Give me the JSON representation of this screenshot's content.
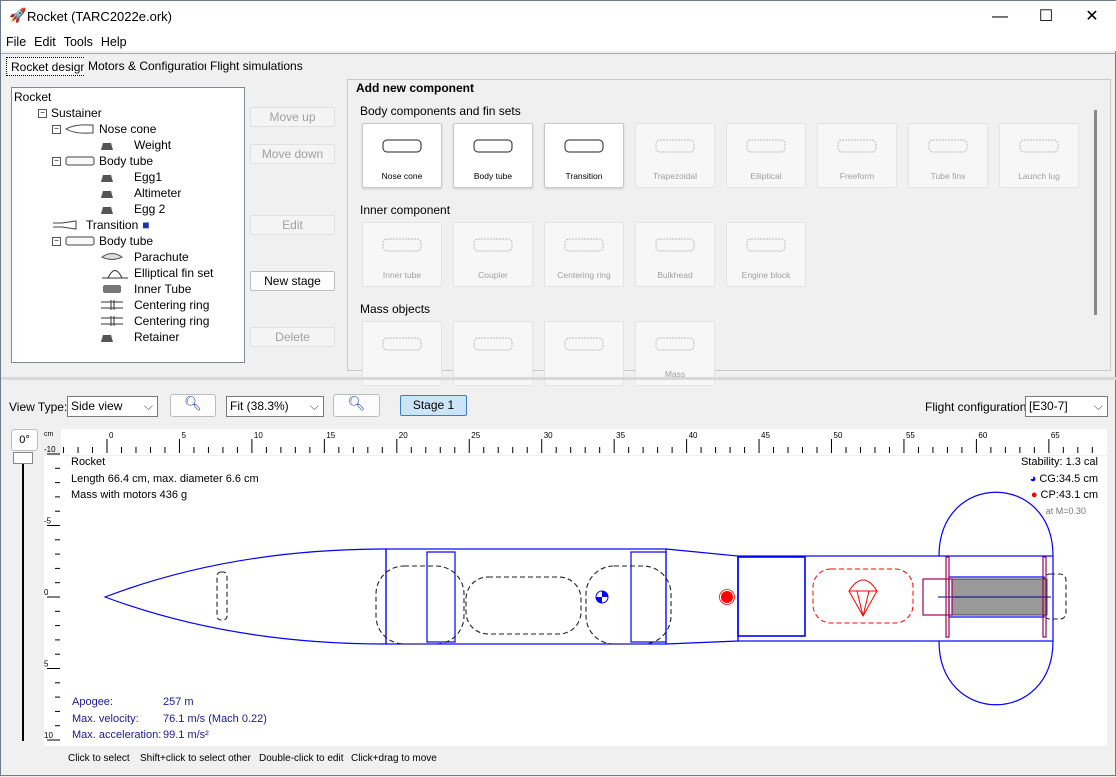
{
  "window": {
    "title": "Rocket (TARC2022e.ork)",
    "minimize": "—",
    "maximize": "☐",
    "close": "✕"
  },
  "menu": [
    "File",
    "Edit",
    "Tools",
    "Help"
  ],
  "tabs": [
    "Rocket design",
    "Motors & Configuration",
    "Flight simulations"
  ],
  "tree": [
    {
      "label": "Rocket",
      "icon": "none"
    },
    {
      "label": "Sustainer",
      "icon": "none"
    },
    {
      "label": "Nose cone",
      "icon": "nose-cone-icon"
    },
    {
      "label": "Weight",
      "icon": "mass-icon"
    },
    {
      "label": "Body tube",
      "icon": "body-tube-icon"
    },
    {
      "label": "Egg1",
      "icon": "mass-icon"
    },
    {
      "label": "Altimeter",
      "icon": "mass-icon"
    },
    {
      "label": "Egg 2",
      "icon": "mass-icon"
    },
    {
      "label": "Transition",
      "icon": "transition-icon"
    },
    {
      "label": "Body tube",
      "icon": "body-tube-icon"
    },
    {
      "label": "Parachute",
      "icon": "parachute-icon"
    },
    {
      "label": "Elliptical fin set",
      "icon": "elliptical-fin-icon"
    },
    {
      "label": "Inner Tube",
      "icon": "inner-tube-icon"
    },
    {
      "label": "Centering ring",
      "icon": "centering-ring-icon"
    },
    {
      "label": "Centering ring",
      "icon": "centering-ring-icon"
    },
    {
      "label": "Retainer",
      "icon": "mass-icon"
    }
  ],
  "side_buttons": {
    "move_up": "Move up",
    "move_down": "Move down",
    "edit": "Edit",
    "new_stage": "New stage",
    "delete": "Delete"
  },
  "add_component": {
    "title": "Add new component",
    "body_section": "Body components and fin sets",
    "body": [
      {
        "label": "Nose cone",
        "enabled": true
      },
      {
        "label": "Body tube",
        "enabled": true
      },
      {
        "label": "Transition",
        "enabled": true
      },
      {
        "label": "Trapezoidal",
        "enabled": false
      },
      {
        "label": "Elliptical",
        "enabled": false
      },
      {
        "label": "Freeform",
        "enabled": false
      },
      {
        "label": "Tube fins",
        "enabled": false
      },
      {
        "label": "Launch lug",
        "enabled": false
      }
    ],
    "inner_section": "Inner component",
    "inner": [
      {
        "label": "Inner tube"
      },
      {
        "label": "Coupler"
      },
      {
        "label": "Centering ring"
      },
      {
        "label": "Bulkhead"
      },
      {
        "label": "Engine block"
      }
    ],
    "mass_section": "Mass objects",
    "mass": [
      {
        "label": ""
      },
      {
        "label": ""
      },
      {
        "label": ""
      },
      {
        "label": "Mass"
      }
    ]
  },
  "view": {
    "view_type_label": "View Type:",
    "view_type": "Side view",
    "zoom": "Fit (38.3%)",
    "stage": "Stage 1",
    "flight_config_label": "Flight configuration:",
    "flight_config": "[E30-7]",
    "rotation": "0°",
    "unit": "cm"
  },
  "ruler": {
    "x_ticks": [
      "0",
      "5",
      "10",
      "15",
      "20",
      "25",
      "30",
      "35",
      "40",
      "45",
      "50",
      "55",
      "60",
      "65"
    ],
    "y_ticks": [
      "-10",
      "-5",
      "0",
      "5",
      "10"
    ]
  },
  "info": {
    "name": "Rocket",
    "dims": "Length 66.4 cm, max. diameter 6.6 cm",
    "mass": "Mass with motors 436 g",
    "stability": "Stability:  1.3 cal",
    "cg": "CG:34.5 cm",
    "cp": "CP:43.1 cm",
    "mach": "at M=0.30"
  },
  "sim": {
    "apogee_label": "Apogee:",
    "apogee": "257 m",
    "vel_label": "Max. velocity:",
    "vel": "76.1 m/s  (Mach 0.22)",
    "acc_label": "Max. acceleration:",
    "acc": "99.1 m/s²"
  },
  "status": [
    "Click to select",
    "Shift+click to select other",
    "Double-click to edit",
    "Click+drag to move"
  ],
  "colors": {
    "outline": "#0000ff",
    "cp": "#ff0000",
    "motor": "#999999",
    "stage_btn": "#cce4f7"
  }
}
